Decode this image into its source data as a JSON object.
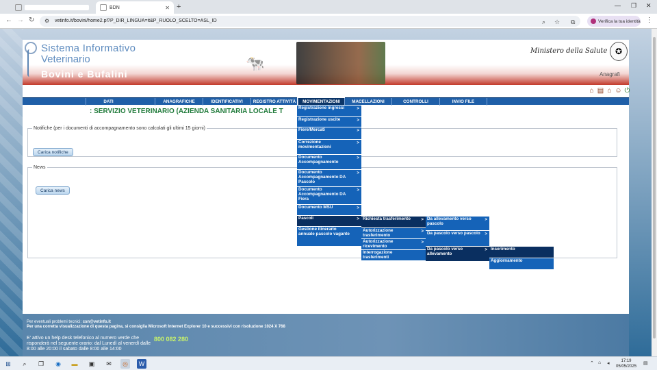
{
  "browser": {
    "tabs": [
      {
        "title": ""
      },
      {
        "title": "BDN"
      }
    ],
    "new_tab": "+",
    "url": "vetinfo.it/bovini/home2.pl?P_DIR_LINGUA=it&P_RUOLO_SCELTO=ASL_ID",
    "verify_label": "Verifica la tua identità"
  },
  "header": {
    "title_line1": "Sistema Informativo",
    "title_line2": "Veterinario",
    "subtitle": "Bovini e Bufalini",
    "ministry": "Ministero della Salute",
    "anagrafi": "Anagrafi"
  },
  "menu": [
    "DATI",
    "ANAGRAFICHE",
    "IDENTIFICATIVI",
    "REGISTRO ATTIVITÀ",
    "MOVIMENTAZIONI",
    "MACELLAZIONI",
    "CONTROLLI",
    "INVIO FILE"
  ],
  "service_title": ": SERVIZIO VETERINARIO (AZIENDA SANITARIA LOCALE T",
  "notifiche": {
    "legend": "Notifiche (per i documenti di accompagnamento sono calcolati gli ultimi 15 giorni)",
    "button": "Carica notifiche"
  },
  "news": {
    "legend": "News",
    "button": "Carica news"
  },
  "dropdown_movimentazioni": [
    "Registrazione ingressi",
    "Registrazione uscite",
    "Fiere/Mercati",
    "Correzione movimentazioni",
    "Documento Accompagnamento",
    "Documento Accompagnamento DA Pascolo",
    "Documento Accompagnamento DA Fiera",
    "Documento MSU",
    "Pascoli",
    "Gestione itinerario annuale pascolo vagante"
  ],
  "dropdown_pascoli": [
    "Richiesta trasferimento",
    "Autorizzazione trasferimento",
    "Autorizzazione ricevimento",
    "Interrogazione trasferimenti"
  ],
  "dropdown_richiesta": [
    "Da allevamento verso pascolo",
    "Da pascolo verso pascolo",
    "Da pascolo verso allevamento"
  ],
  "dropdown_allevamento": [
    "Inserimento",
    "Aggiornamento"
  ],
  "arrow": ">",
  "footer": {
    "problems_prefix": "Per eventuali problemi tecnici: ",
    "email": "csn@vetinfo.it",
    "browser_note": "Per una corretta visualizzazione di questa pagina, si consiglia Microsoft Internet Explorer 10 e successivi con risoluzione 1024 X 768",
    "helpdesk": "E' attivo un help desk telefonico al numero verde che risponderà nel seguente orario: dal Lunedì al venerdì dalle 8:00 alle 20:00 il sabato dalle 8:00 alle 14:00",
    "phone": "800 082 280"
  },
  "taskbar": {
    "time": "17:19",
    "date": "05/05/2025"
  },
  "colors": {
    "menu_blue": "#1f5fa8",
    "dropdown_blue": "#1563b8",
    "selected_dark": "#0a2f60",
    "service_green": "#1f7a3a",
    "header_red": "#c23a2b"
  }
}
